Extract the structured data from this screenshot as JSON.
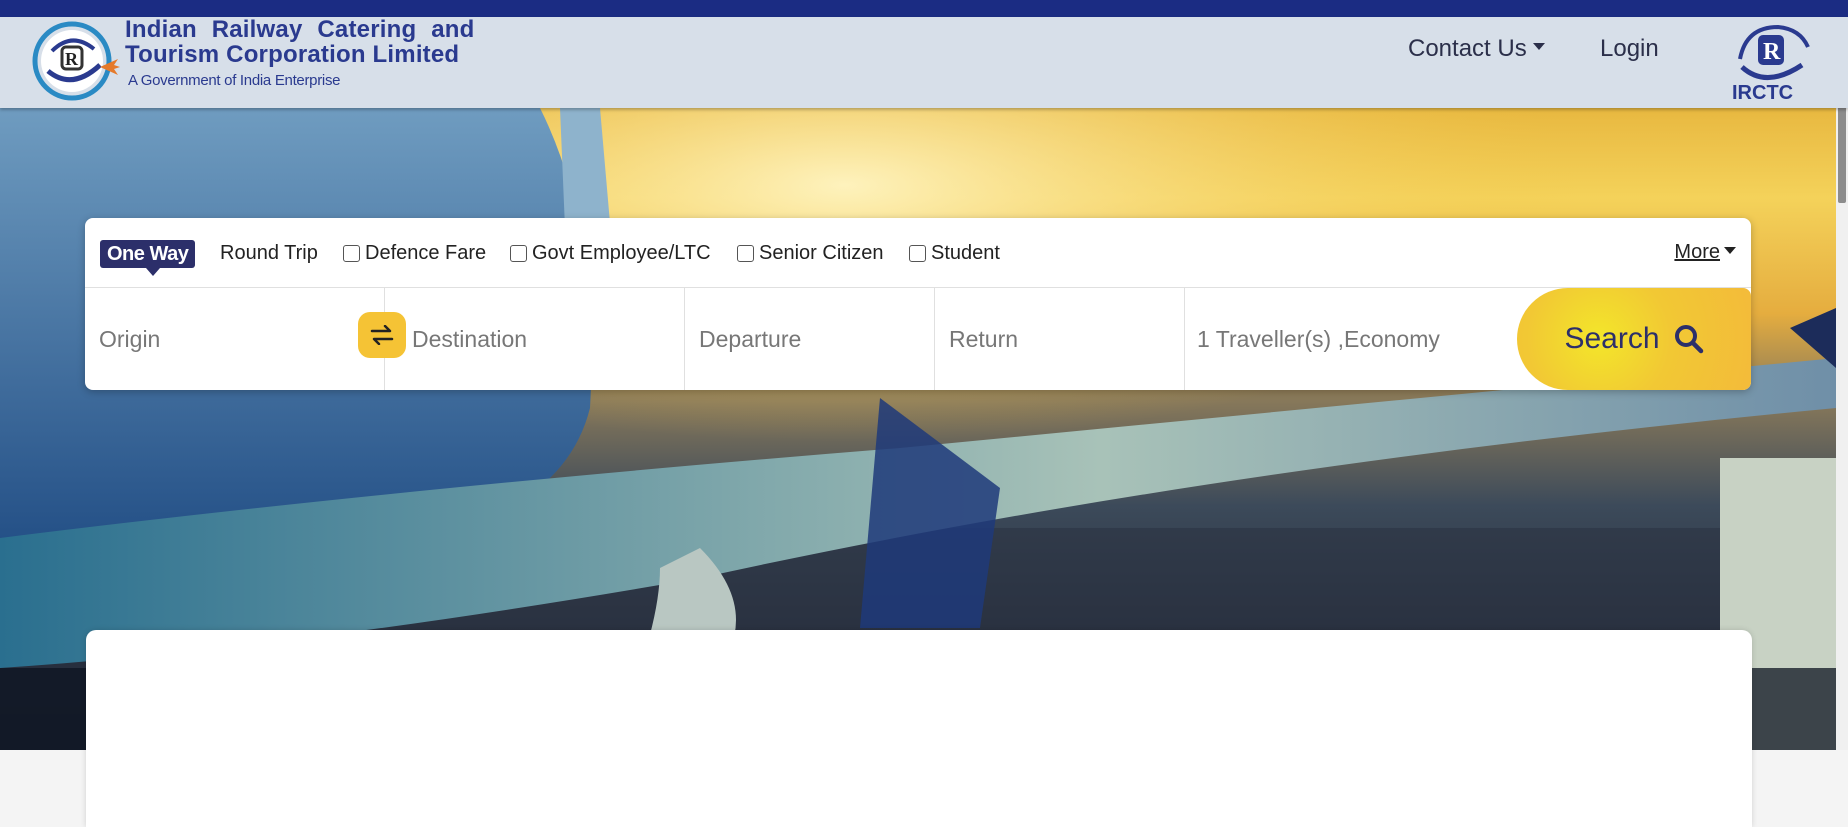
{
  "header": {
    "brand_line1": "Indian Railway Catering and",
    "brand_line2": "Tourism Corporation Limited",
    "brand_line3": "A Government of India Enterprise",
    "right_logo_text": "IRCTC",
    "nav": {
      "contact_label": "Contact Us",
      "login_label": "Login"
    }
  },
  "search": {
    "trip_types": {
      "one_way": "One Way",
      "round_trip": "Round Trip"
    },
    "options": {
      "defence": "Defence Fare",
      "govt": "Govt Employee/LTC",
      "senior": "Senior Citizen",
      "student": "Student"
    },
    "more_label": "More",
    "fields": {
      "origin": "Origin",
      "destination": "Destination",
      "departure": "Departure",
      "return": "Return",
      "travellers": "1 Traveller(s) ,Economy"
    },
    "search_label": "Search"
  },
  "colors": {
    "top_bar": "#1b2c83",
    "header_bg": "#d7dfe9",
    "accent_yellow": "#f5c335",
    "brand_navy": "#2c2f6a"
  },
  "icons": [
    "irctc-logo-icon",
    "plane-icon",
    "swap-icon",
    "search-icon",
    "caret-down-icon"
  ]
}
